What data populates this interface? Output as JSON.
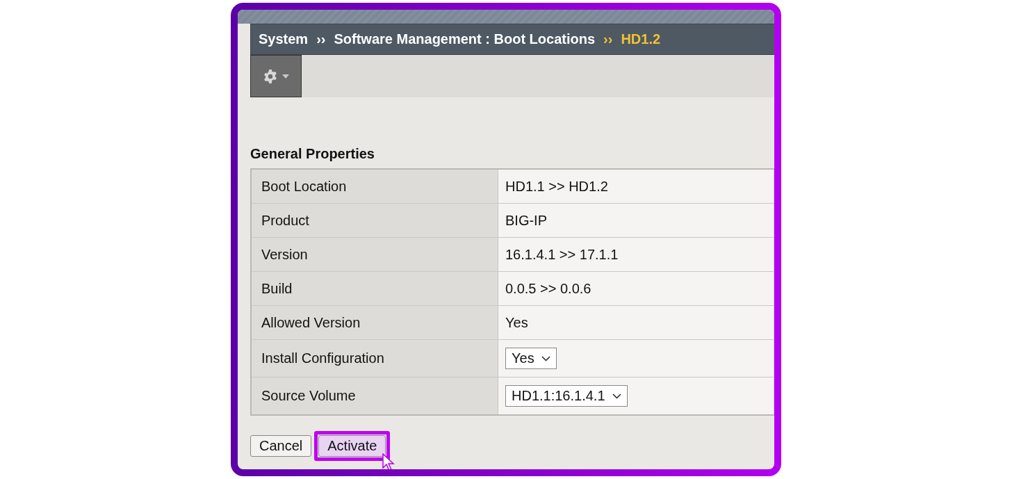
{
  "breadcrumb": [
    {
      "label": "System",
      "current": false
    },
    {
      "label": "Software Management : Boot Locations",
      "current": false
    },
    {
      "label": "HD1.2",
      "current": true
    }
  ],
  "breadcrumb_separator": "››",
  "section_title": "General Properties",
  "properties": [
    {
      "kind": "text",
      "label": "Boot Location",
      "value": "HD1.1 >> HD1.2"
    },
    {
      "kind": "text",
      "label": "Product",
      "value": "BIG-IP"
    },
    {
      "kind": "text",
      "label": "Version",
      "value": "16.1.4.1 >> 17.1.1"
    },
    {
      "kind": "text",
      "label": "Build",
      "value": "0.0.5 >> 0.0.6"
    },
    {
      "kind": "text",
      "label": "Allowed Version",
      "value": "Yes"
    },
    {
      "kind": "select",
      "label": "Install Configuration",
      "value": "Yes"
    },
    {
      "kind": "select",
      "label": "Source Volume",
      "value": "HD1.1:16.1.4.1"
    }
  ],
  "buttons": [
    {
      "label": "Cancel",
      "highlighted": false
    },
    {
      "label": "Activate",
      "highlighted": true
    }
  ]
}
